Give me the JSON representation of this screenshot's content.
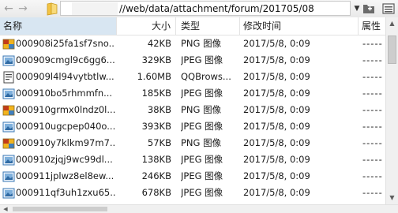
{
  "toolbar": {
    "back_icon": "back-arrow-icon",
    "forward_icon": "forward-arrow-icon",
    "folder_icon": "folder-icon",
    "path": "//web/data/attachment/forum/201705/08",
    "dropdown_icon": "chevron-down-icon",
    "new_folder_icon": "new-folder-icon",
    "list_view_icon": "list-view-icon"
  },
  "columns": {
    "name": "名称",
    "size": "大小",
    "type": "类型",
    "modified": "修改时间",
    "attributes": "属性"
  },
  "files": [
    {
      "icon": "png-file-icon",
      "name": "000908i25fa1sf7sno...",
      "size": "42KB",
      "type": "PNG 图像",
      "modified": "2017/5/8, 0:09",
      "attributes": "-----"
    },
    {
      "icon": "jpeg-file-icon",
      "name": "000909cmgl9c6gg6...",
      "size": "329KB",
      "type": "JPEG 图像",
      "modified": "2017/5/8, 0:09",
      "attributes": "-----"
    },
    {
      "icon": "html-file-icon",
      "name": "000909l4l94vytbtlw...",
      "size": "1.60MB",
      "type": "QQBrows...",
      "modified": "2017/5/8, 0:09",
      "attributes": "-----"
    },
    {
      "icon": "jpeg-file-icon",
      "name": "000910bo5rhmmfn...",
      "size": "185KB",
      "type": "JPEG 图像",
      "modified": "2017/5/8, 0:09",
      "attributes": "-----"
    },
    {
      "icon": "png-file-icon",
      "name": "000910grmx0lndz0l...",
      "size": "38KB",
      "type": "PNG 图像",
      "modified": "2017/5/8, 0:09",
      "attributes": "-----"
    },
    {
      "icon": "jpeg-file-icon",
      "name": "000910ugcpep040o...",
      "size": "393KB",
      "type": "JPEG 图像",
      "modified": "2017/5/8, 0:09",
      "attributes": "-----"
    },
    {
      "icon": "png-file-icon",
      "name": "000910y7klkm97m7...",
      "size": "57KB",
      "type": "PNG 图像",
      "modified": "2017/5/8, 0:09",
      "attributes": "-----"
    },
    {
      "icon": "jpeg-file-icon",
      "name": "000910zjqj9wc99dl...",
      "size": "138KB",
      "type": "JPEG 图像",
      "modified": "2017/5/8, 0:09",
      "attributes": "-----"
    },
    {
      "icon": "jpeg-file-icon",
      "name": "000911jplwz8el8ew...",
      "size": "246KB",
      "type": "JPEG 图像",
      "modified": "2017/5/8, 0:09",
      "attributes": "-----"
    },
    {
      "icon": "jpeg-file-icon",
      "name": "000911qf3uh1zxu65...",
      "size": "678KB",
      "type": "JPEG 图像",
      "modified": "2017/5/8, 0:09",
      "attributes": "-----"
    }
  ],
  "colors": {
    "header_active": "#d8e6f2",
    "png_icon_a": "#f2b41d",
    "png_icon_b": "#c23b1a",
    "jpeg_icon": "#3a78b5"
  }
}
